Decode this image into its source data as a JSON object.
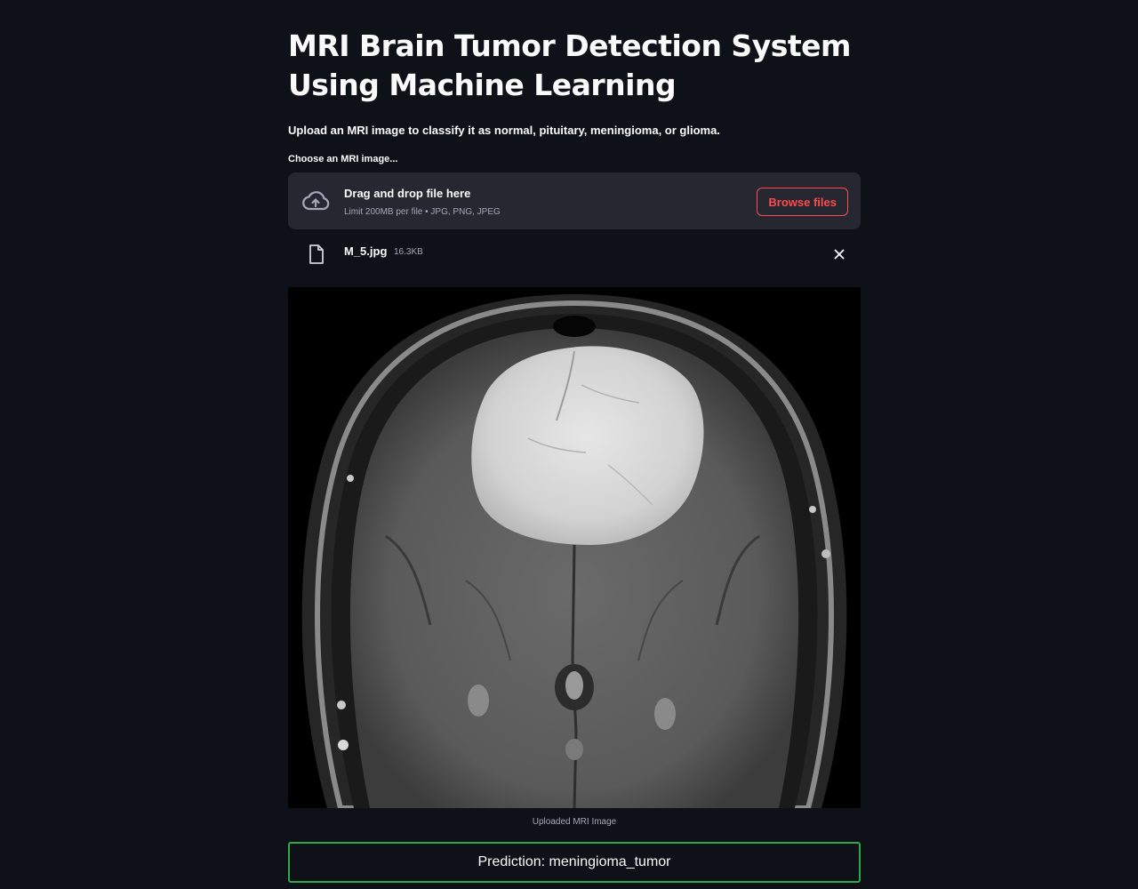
{
  "header": {
    "title": "MRI Brain Tumor Detection System Using Machine Learning",
    "subtitle": "Upload an MRI image to classify it as normal, pituitary, meningioma, or glioma."
  },
  "uploader": {
    "label": "Choose an MRI image...",
    "drop_text": "Drag and drop file here",
    "limit_text": "Limit 200MB per file • JPG, PNG, JPEG",
    "browse_label": "Browse files",
    "icon": "cloud-upload-icon"
  },
  "uploaded_file": {
    "name": "M_5.jpg",
    "size": "16.3KB",
    "icon": "file-icon",
    "remove_icon": "close-icon"
  },
  "image": {
    "caption": "Uploaded MRI Image"
  },
  "result": {
    "prediction": "Prediction: meningioma_tumor"
  },
  "colors": {
    "background": "#0e1117",
    "dropzone": "#262730",
    "accent": "#ff4b4b",
    "success_border": "#2fa84a",
    "muted_text": "#a3a8b8"
  }
}
